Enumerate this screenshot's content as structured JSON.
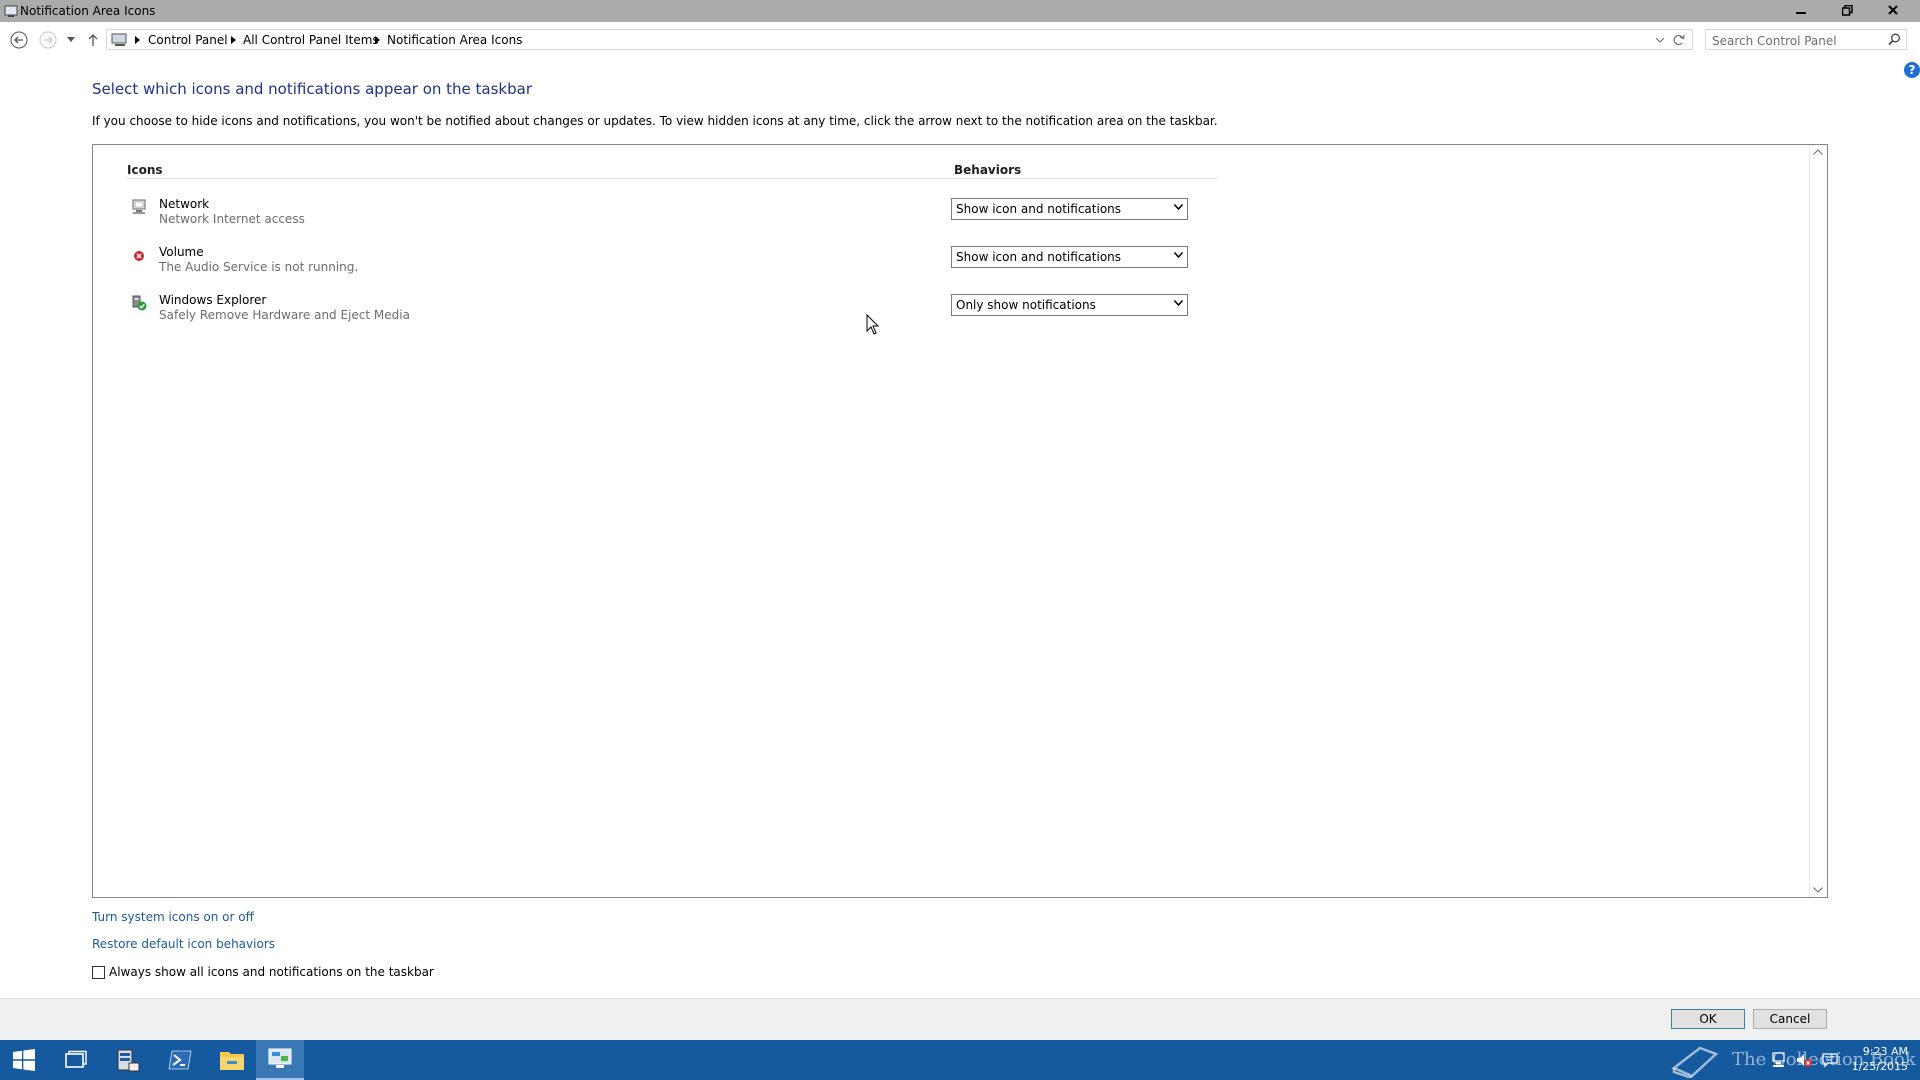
{
  "window": {
    "title": "Notification Area Icons",
    "controls": [
      "minimize",
      "restore",
      "close"
    ]
  },
  "address_bar": {
    "breadcrumbs": [
      "Control Panel",
      "All Control Panel Items",
      "Notification Area Icons"
    ]
  },
  "search": {
    "placeholder": "Search Control Panel"
  },
  "content": {
    "heading": "Select which icons and notifications appear on the taskbar",
    "intro": "If you choose to hide icons and notifications, you won't be notified about changes or updates. To view hidden icons at any time, click the arrow next to the notification area on the taskbar.",
    "columns": {
      "icons": "Icons",
      "behaviors": "Behaviors"
    },
    "rows": [
      {
        "name": "Network",
        "description": "Network Internet access",
        "behavior": "Show icon and notifications",
        "icon": "network-icon"
      },
      {
        "name": "Volume",
        "description": "The Audio Service is not running.",
        "behavior": "Show icon and notifications",
        "icon": "volume-error-icon"
      },
      {
        "name": "Windows Explorer",
        "description": "Safely Remove Hardware and Eject Media",
        "behavior": "Only show notifications",
        "icon": "safely-remove-icon"
      }
    ]
  },
  "links": {
    "system_icons": "Turn system icons on or off",
    "restore_defaults": "Restore default icon behaviors"
  },
  "checkbox": {
    "label": "Always show all icons and notifications on the taskbar",
    "checked": false
  },
  "buttons": {
    "ok": "OK",
    "cancel": "Cancel"
  },
  "taskbar": {
    "items": [
      "start-icon",
      "task-view-icon",
      "server-manager-icon",
      "powershell-icon",
      "file-explorer-icon",
      "control-panel-icon"
    ],
    "watermark": "The Collection Book",
    "clock": {
      "time": "9:23 AM",
      "date": "1/25/2015"
    }
  },
  "colors": {
    "heading": "#1e3287",
    "link": "#1e5aa0",
    "taskbar": "#15599e",
    "titlebar": "#ababab"
  }
}
